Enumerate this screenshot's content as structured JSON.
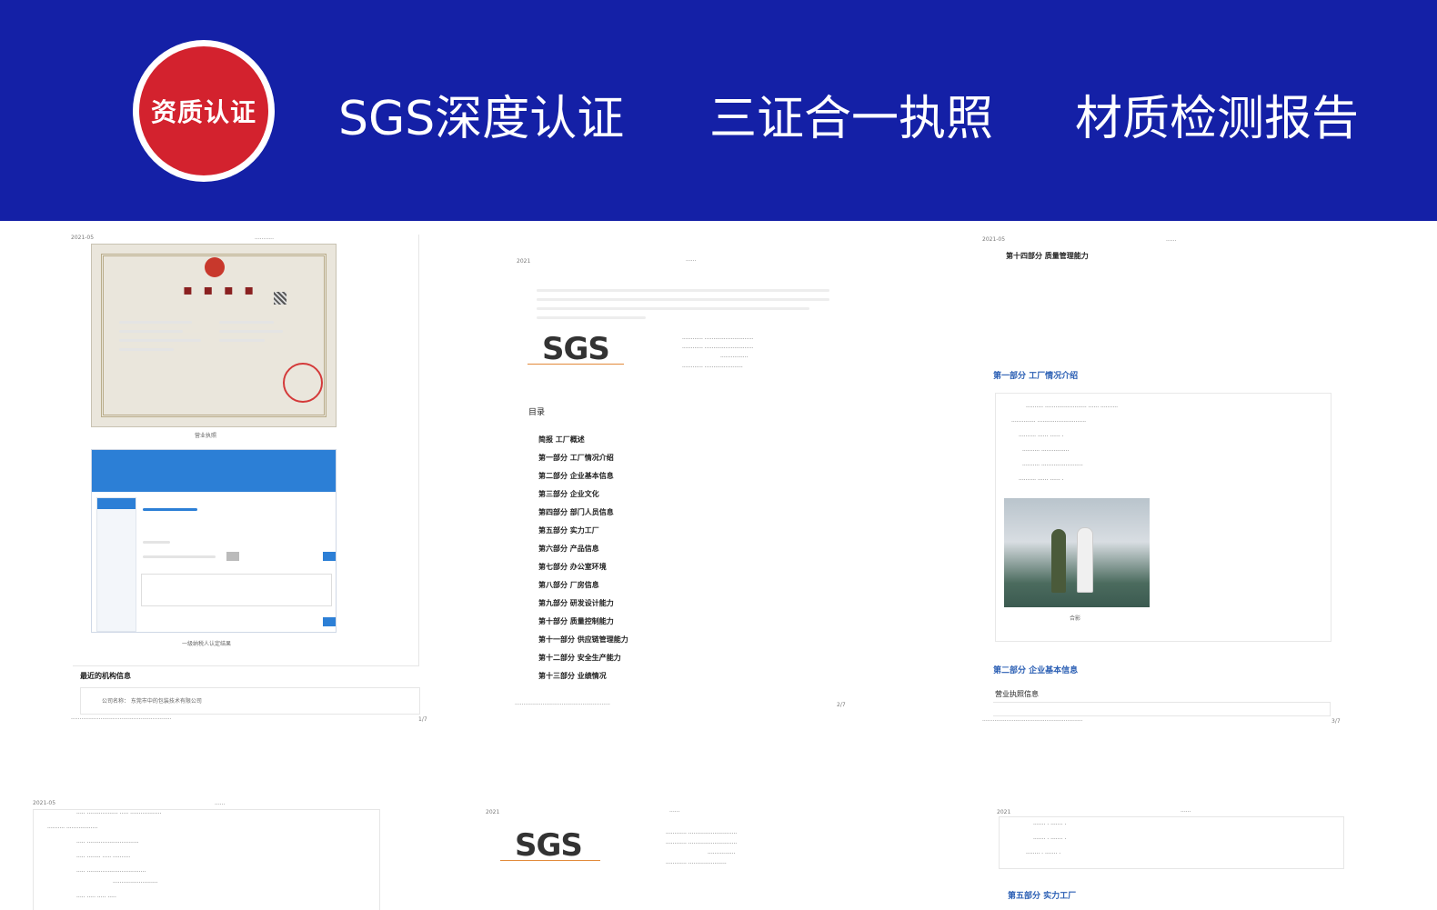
{
  "banner": {
    "badge": "资质认证",
    "titles": [
      "SGS深度认证",
      "三证合一执照",
      "材质检测报告"
    ]
  },
  "doc1": {
    "license_caption": "营业执照",
    "web_caption": "一级纳税人认定结果",
    "section_title": "最近的机构信息",
    "field": "公司名称：  东莞市中的包装技术有限公司"
  },
  "doc2": {
    "logo": "SGS",
    "toc_title": "目录",
    "toc_items": [
      "简报 工厂概述",
      "第一部分 工厂情况介绍",
      "第二部分 企业基本信息",
      "第三部分 企业文化",
      "第四部分 部门人员信息",
      "第五部分 实力工厂",
      "第六部分 产品信息",
      "第七部分 办公室环境",
      "第八部分 厂房信息",
      "第九部分 研发设计能力",
      "第十部分 质量控制能力",
      "第十一部分 供应链管理能力",
      "第十二部分 安全生产能力",
      "第十三部分 业绩情况"
    ]
  },
  "doc3": {
    "top_heading": "第十四部分 质量管理能力",
    "section1": "第一部分 工厂情况介绍",
    "photo_caption": "合影",
    "section2": "第二部分 企业基本信息",
    "sub2": "营业执照信息"
  },
  "doc5": {
    "logo": "SGS"
  },
  "doc6": {
    "section": "第五部分 实力工厂"
  }
}
